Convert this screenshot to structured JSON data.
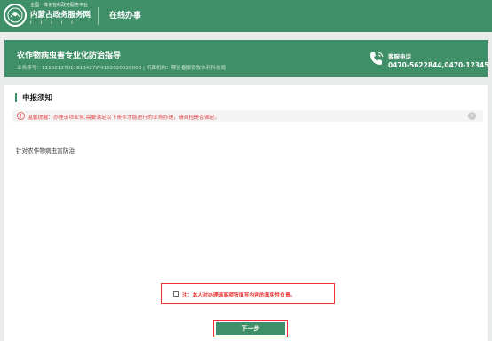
{
  "header": {
    "brand_small": "全国一体化在线政务服务平台",
    "brand_name": "内蒙古政务服务网",
    "brand_strokes": "ⅰ ⅰ ⅰ ⅰ ⅰ",
    "nav_title": "在线办事"
  },
  "banner": {
    "title": "农作物病虫害专业化防治指导",
    "subtitle": "业务序号：11152127011613427W4152020028000 | 所属机构：鄂伦春旗农牧水利科技局",
    "hotline_label": "客服电话",
    "hotline_number": "0470-5622844,0470-12345"
  },
  "notice_section": {
    "title": "申报须知",
    "warning": "温馨提醒：办理该项业务,需要满足以下条件才能进行的业务办理，请自检是否满足。",
    "body": "针对农作物病虫害防治"
  },
  "agreement": {
    "text": "注：本人对办理该事项所填写内容的真实性负责。"
  },
  "actions": {
    "next_label": "下一步"
  },
  "colors": {
    "primary": "#3f8f68",
    "warning": "#e04b4b"
  }
}
